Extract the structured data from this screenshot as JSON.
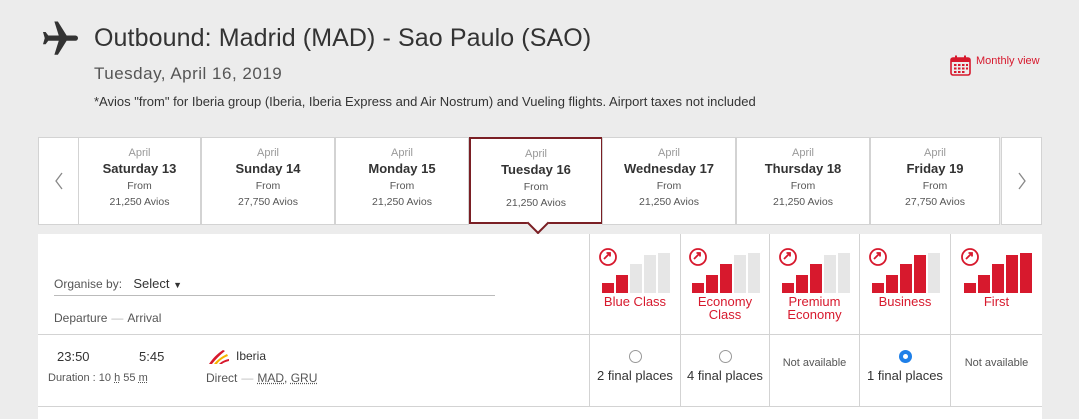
{
  "header": {
    "title": "Outbound: Madrid (MAD) - Sao Paulo (SAO)",
    "date": "Tuesday, April 16, 2019",
    "note": "*Avios \"from\" for Iberia group (Iberia, Iberia Express and Air Nostrum) and Vueling flights. Airport taxes not included",
    "monthly_view": "Monthly view",
    "accent_color": "#d7192d"
  },
  "days": [
    {
      "month": "April",
      "day": "Saturday 13",
      "from": "From",
      "avios": "21,250 Avios"
    },
    {
      "month": "April",
      "day": "Sunday 14",
      "from": "From",
      "avios": "27,750 Avios"
    },
    {
      "month": "April",
      "day": "Monday 15",
      "from": "From",
      "avios": "21,250 Avios"
    },
    {
      "month": "April",
      "day": "Tuesday 16",
      "from": "From",
      "avios": "21,250 Avios"
    },
    {
      "month": "April",
      "day": "Wednesday 17",
      "from": "From",
      "avios": "21,250 Avios"
    },
    {
      "month": "April",
      "day": "Thursday 18",
      "from": "From",
      "avios": "21,250 Avios"
    },
    {
      "month": "April",
      "day": "Friday 19",
      "from": "From",
      "avios": "27,750 Avios"
    }
  ],
  "selected_day_index": 3,
  "results": {
    "organise_label": "Organise by:",
    "organise_value": "Select",
    "departure_label": "Departure",
    "arrival_label": "Arrival",
    "classes": [
      {
        "name": "Blue Class",
        "level": 2
      },
      {
        "name": "Economy Class",
        "level": 3
      },
      {
        "name": "Premium Economy",
        "level": 3
      },
      {
        "name": "Business",
        "level": 4
      },
      {
        "name": "First",
        "level": 5
      }
    ],
    "flights": [
      {
        "departure": "23:50",
        "arrival": "5:45",
        "duration_label": "Duration :",
        "duration_h": "10",
        "duration_h_unit": "h",
        "duration_m": "55",
        "duration_m_unit": "m",
        "airline": "Iberia",
        "route_type": "Direct",
        "origin": "MAD",
        "destination": "GRU",
        "fares": [
          {
            "status": "2 final places",
            "selected": false
          },
          {
            "status": "4 final places",
            "selected": false
          },
          {
            "status": "Not available",
            "selected": false
          },
          {
            "status": "1 final places",
            "selected": true
          },
          {
            "status": "Not available",
            "selected": false
          }
        ]
      }
    ]
  }
}
